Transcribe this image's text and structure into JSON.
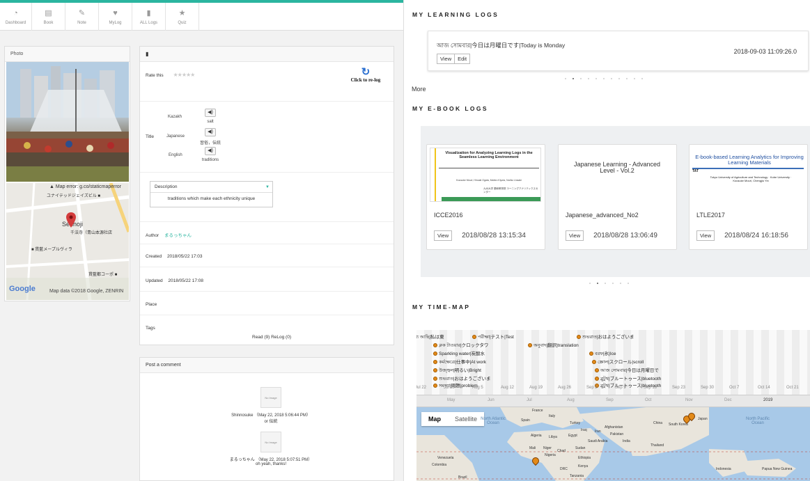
{
  "nav": [
    {
      "label": "Dashboard",
      "icon": "dashboard-icon",
      "glyph": "◔"
    },
    {
      "label": "Book",
      "icon": "book-icon",
      "glyph": "▤"
    },
    {
      "label": "Note",
      "icon": "pencil-icon",
      "glyph": "✎"
    },
    {
      "label": "MyLog",
      "icon": "heart-icon",
      "glyph": "♥"
    },
    {
      "label": "ALL Logs",
      "icon": "file-icon",
      "glyph": "▮"
    },
    {
      "label": "Quiz",
      "icon": "star-icon",
      "glyph": "★"
    }
  ],
  "photo": {
    "title": "Photo",
    "map_error": "▲ Map error: g.co/staticmaperror",
    "map_labels": [
      "ユナイテッドジェイズビル ■",
      "Senhoji",
      "千法寺（青山本源社店",
      "■ 貫藍メープルヴィラ",
      "貫藍都コーポ ■"
    ],
    "map_data": "Map data ©2018 Google, ZENRIN",
    "google": "Google"
  },
  "detail": {
    "header_icon": "▮",
    "rate_label": "Rate this",
    "stars": "★★★★★",
    "relog_label": "Click to re-log",
    "title_label": "Title",
    "translations": [
      {
        "lang": "Kazakh",
        "text": "salt"
      },
      {
        "lang": "Japanese",
        "text": "習俗，伝統"
      },
      {
        "lang": "English",
        "text": "traditions"
      }
    ],
    "speaker_glyph": "◀)",
    "description_label": "Description",
    "description_caret": "▼",
    "description_value": "traditions which make each ethnicity unique",
    "author_label": "Author",
    "author_name": "まるっちゃん",
    "created_label": "Created",
    "created_value": "2018/05/22 17:03",
    "updated_label": "Updated",
    "updated_value": "2018/05/22 17:08",
    "place_label": "Place",
    "tags_label": "Tags",
    "read_relog": "Read (9) ReLog (0)"
  },
  "comments": {
    "title": "Post a comment",
    "items": [
      {
        "noimage": "No Image",
        "meta": "Shinnosuke （May 22, 2018 5:06:44 PM）",
        "text": "or 伝統"
      },
      {
        "noimage": "No Image",
        "meta": "まるっちゃん （May 22, 2018 5:07:51 PM）",
        "text": "oh yeah, thanks!"
      }
    ]
  },
  "learning_logs": {
    "title": "MY LEARNING LOGS",
    "entry_text": "আজ সোমবার|今日は月曜日です|Today is Monday",
    "entry_date": "2018-09-03 11:09:26.0",
    "view_label": "View",
    "edit_label": "Edit",
    "more_label": "More"
  },
  "ebook_logs": {
    "title": "MY E-BOOK LOGS",
    "view_label": "View",
    "books": [
      {
        "name": "ICCE2016",
        "date": "2018/08/28 13:15:34",
        "cover_title": "Visualization for Analyzing Learning Logs in the Seamless Learning Environment",
        "cover_authors": "Kousuke Mouri, Hiroaki Ogata, Mahiro Kiyota, Noriko Uosaki",
        "cover_footer": "九州大学 基幹教育院 ラーニングアナリティクスセンター"
      },
      {
        "name": "Japanese_advanced_No2",
        "date": "2018/08/28 13:06:49",
        "cover_title": "Japanese Learning - Advanced Level - Vol.2",
        "cover_authors": "",
        "cover_footer": ""
      },
      {
        "name": "LTLE2017",
        "date": "2018/08/24 16:18:56",
        "cover_title": "E-book-based Learning Analytics for Improving Learning Materials",
        "cover_authors": "Tokyo University of Agriculture and Technology · Kobe University · Kousuke Mouri, Chengjiu Yin",
        "cover_footer": "TAT"
      }
    ]
  },
  "time_map": {
    "title": "MY TIME-MAP",
    "events": [
      "র মধ্যে আছি|私は東",
      "পরীক্ষা|テスト|Test",
      "শুভরাত|おはようございま",
      "ক্লক টাওয়ার|クロックタワ",
      "অনুবাদ|翻訳|translation",
      "Sparkling water|炭酸水",
      "বরফ|氷|Ice",
      "কর্মক্ষেত্রে|仕事中|At work",
      "স্ক্রোল|スクロール|scroll",
      "উজ্জ্বল|明るい|Bright",
      "আজ সোমবার|今日は月曜日で",
      "শুভরাত|おはようございま",
      "ব্লুটুথ|ブルートゥース|bluetooth",
      "সমস্যা|問題|problem",
      "ব্লুটুথ|ブルートゥース|bluetooth"
    ],
    "ticks": [
      "Jul 22",
      "Jul 29",
      "Aug 5",
      "Aug 12",
      "Aug 19",
      "Aug 26",
      "Sep 2",
      "Sep 9",
      "Sep 16",
      "Sep 23",
      "Sep 30",
      "Oct 7",
      "Oct 14",
      "Oct 21"
    ],
    "months": [
      "May",
      "Jun",
      "Jul",
      "Aug",
      "Sep",
      "Oct",
      "Nov",
      "Dec",
      "2019"
    ],
    "map_tab": "Map",
    "satellite_tab": "Satellite",
    "places": [
      "France",
      "Italy",
      "Spain",
      "Turkey",
      "Iraq",
      "Iran",
      "Afghanistan",
      "Pakistan",
      "China",
      "South Korea",
      "Japan",
      "Algeria",
      "Libya",
      "Egypt",
      "Saudi Arabia",
      "India",
      "Thailand",
      "Mali",
      "Niger",
      "Chad",
      "Sudan",
      "Nigeria",
      "Ethiopia",
      "Venezuela",
      "Colombia",
      "Kenya",
      "DRC",
      "Tanzania",
      "Indonesia",
      "Papua New Guinea",
      "Brazil"
    ],
    "oceans": [
      "North Atlantic Ocean",
      "North Pacific Ocean"
    ]
  }
}
